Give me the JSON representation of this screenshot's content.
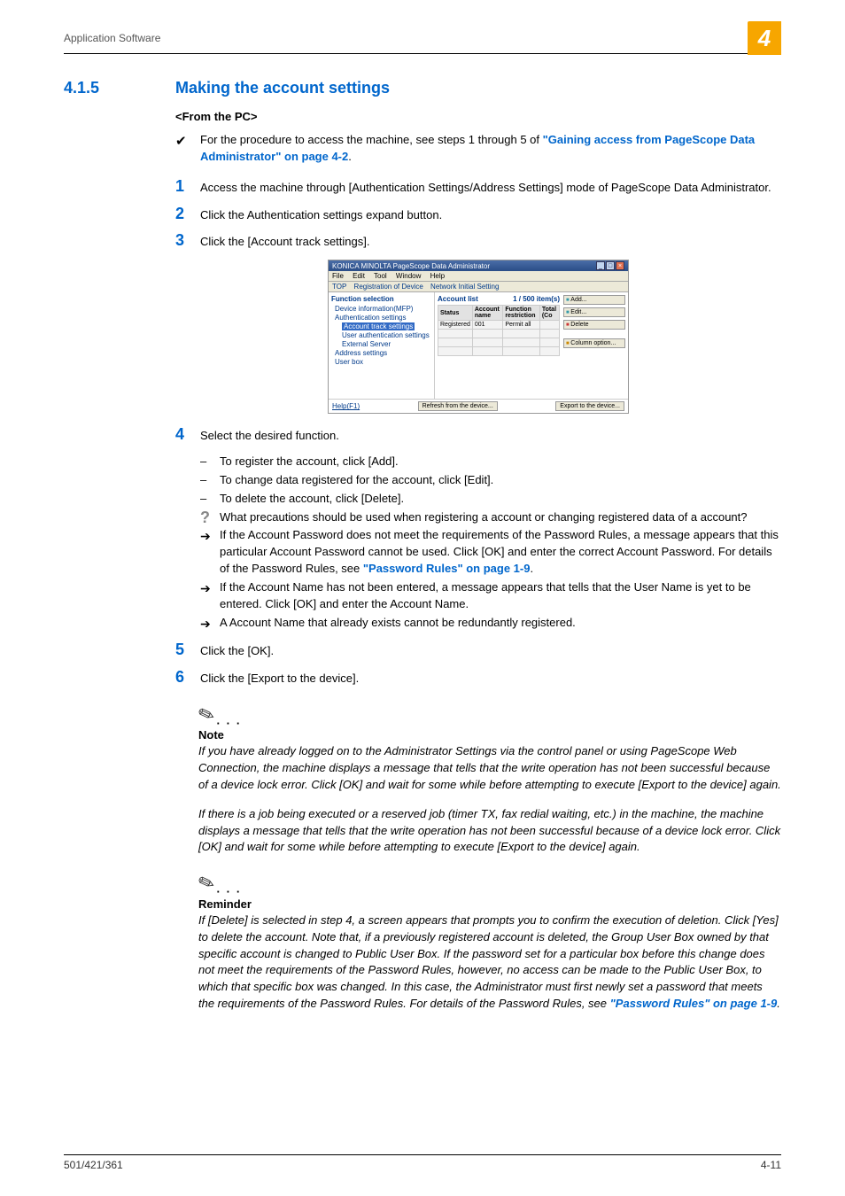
{
  "header": {
    "title": "Application Software",
    "chapter": "4"
  },
  "section": {
    "number": "4.1.5",
    "title": "Making the account settings"
  },
  "sub_heading": "<From the PC>",
  "prereq": {
    "text_a": "For the procedure to access the machine, see steps 1 through 5 of ",
    "link": "\"Gaining access from PageScope Data Administrator\" on page 4-2",
    "text_b": "."
  },
  "steps": {
    "s1": {
      "n": "1",
      "t": "Access the machine through [Authentication Settings/Address Settings] mode of PageScope Data Administrator."
    },
    "s2": {
      "n": "2",
      "t": "Click the Authentication settings expand button."
    },
    "s3": {
      "n": "3",
      "t": "Click the [Account track settings]."
    },
    "s4": {
      "n": "4",
      "t": "Select the desired function.",
      "d1": "To register the account, click [Add].",
      "d2": "To change data registered for the account, click [Edit].",
      "d3": "To delete the account, click [Delete].",
      "q": "What precautions should be used when registering a account or changing registered data of a account?",
      "a1a": "If the Account Password does not meet the requirements of the Password Rules, a message appears that this particular Account Password cannot be used. Click [OK] and enter the correct Account Password. For details of the Password Rules, see ",
      "a1link": "\"Password Rules\" on page 1-9",
      "a1b": ".",
      "a2": "If the Account Name has not been entered, a message appears that tells that the User Name is yet to be entered. Click [OK] and enter the Account Name.",
      "a3": "A Account Name that already exists cannot be redundantly registered."
    },
    "s5": {
      "n": "5",
      "t": "Click the [OK]."
    },
    "s6": {
      "n": "6",
      "t": "Click the [Export to the device]."
    }
  },
  "figure": {
    "title": "KONICA MINOLTA PageScope Data Administrator",
    "menu": {
      "file": "File",
      "edit": "Edit",
      "tool": "Tool",
      "window": "Window",
      "help": "Help"
    },
    "toolbar": {
      "top": "TOP",
      "reg": "Registration of Device",
      "net": "Network Initial Setting"
    },
    "left": {
      "title": "Function selection",
      "tree": {
        "n0": "Device information(MFP)",
        "n1": "Authentication settings",
        "n2": "Account track settings",
        "n3": "User authentication settings",
        "n4": "External Server",
        "n5": "Address settings",
        "n6": "User box"
      }
    },
    "right": {
      "title": "Account list",
      "count": "1 / 500 item(s)",
      "th": {
        "c0": "Status",
        "c1": "Account name",
        "c2": "Function restriction",
        "c3": "Total (Co"
      },
      "row": {
        "c0": "Registered",
        "c1": "001",
        "c2": "Permit all",
        "c3": ""
      },
      "buttons": {
        "add": "Add...",
        "edit": "Edit...",
        "del": "Delete",
        "col": "Column option..."
      }
    },
    "footer": {
      "help": "Help(F1)",
      "refresh": "Refresh from the device...",
      "export": "Export to the device..."
    }
  },
  "note1": {
    "label": "Note",
    "p1": "If you have already logged on to the Administrator Settings via the control panel or using PageScope Web Connection, the machine displays a message that tells that the write operation has not been successful because of a device lock error. Click [OK] and wait for some while before attempting to execute [Export to the device] again.",
    "p2": "If there is a job being executed or a reserved job (timer TX, fax redial waiting, etc.) in the machine, the machine displays a message that tells that the write operation has not been successful because of a device lock error. Click [OK] and wait for some while before attempting to execute [Export to the device] again."
  },
  "note2": {
    "label": "Reminder",
    "p1a": "If [Delete] is selected in step 4, a screen appears that prompts you to confirm the execution of deletion. Click [Yes] to delete the account. Note that, if a previously registered account is deleted, the Group User Box owned by that specific account is changed to Public User Box. If the password set for a particular box before this change does not meet the requirements of the Password Rules, however, no access can be made to the Public User Box, to which that specific box was changed. In this case, the Administrator must first newly set a password that meets the requirements of the Password Rules. For details of the Password Rules, see ",
    "p1link": "\"Password Rules\" on page 1-9",
    "p1b": "."
  },
  "footer": {
    "left": "501/421/361",
    "right": "4-11"
  }
}
